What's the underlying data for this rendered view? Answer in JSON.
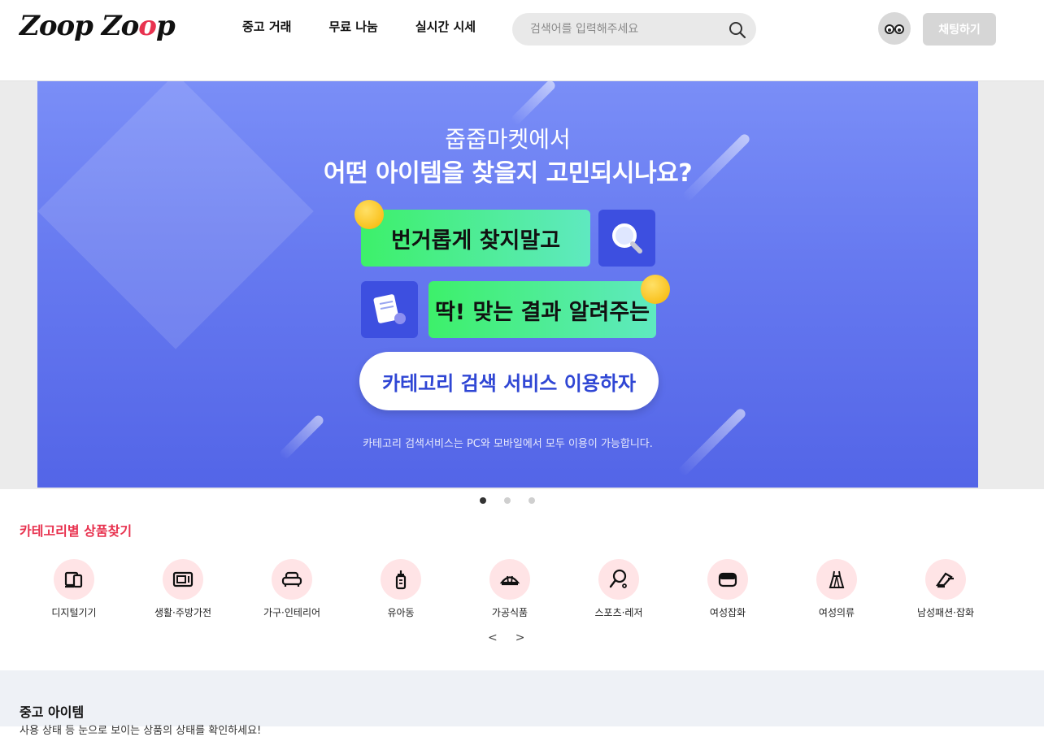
{
  "logo": {
    "text_a": "Zoop Zo",
    "text_b": "o",
    "text_c": "p"
  },
  "nav": [
    {
      "label": "중고 거래"
    },
    {
      "label": "무료 나눔"
    },
    {
      "label": "실시간 시세"
    }
  ],
  "search": {
    "placeholder": "검색어를 입력해주세요",
    "icon": "search-icon"
  },
  "header": {
    "chat_label": "채팅하기",
    "avatar_icon": "avatar-face-icon"
  },
  "banner": {
    "title1": "줍줍마켓에서",
    "title2": "어떤 아이템을 찾을지 고민되시나요?",
    "pill1": "번거롭게 찾지말고",
    "pill2": "딱! 맞는 결과 알려주는",
    "cta": "카테고리 검색 서비스 이용하자",
    "note": "카테고리 검색서비스는 PC와 모바일에서 모두 이용이 가능합니다."
  },
  "carousel": {
    "active_index": 0,
    "count": 3
  },
  "category": {
    "title": "카테고리별 상품찾기",
    "items": [
      {
        "label": "디지털기기",
        "icon": "digital-device-icon"
      },
      {
        "label": "생활·주방가전",
        "icon": "appliance-icon"
      },
      {
        "label": "가구·인테리어",
        "icon": "sofa-icon"
      },
      {
        "label": "유아동",
        "icon": "baby-bottle-icon"
      },
      {
        "label": "가공식품",
        "icon": "food-icon"
      },
      {
        "label": "스포츠·레저",
        "icon": "racket-icon"
      },
      {
        "label": "여성잡화",
        "icon": "bag-icon"
      },
      {
        "label": "여성의류",
        "icon": "dress-icon"
      },
      {
        "label": "남성패션·잡화",
        "icon": "shoe-icon"
      }
    ],
    "prev": "<",
    "next": ">"
  },
  "used": {
    "title": "중고 아이템",
    "subtitle": "사용 상태 등 눈으로 보이는 상품의 상태를 확인하세요!"
  },
  "colors": {
    "accent": "#e8324f",
    "banner_blue": "#5d70ee",
    "pill_green": "#3df06a",
    "category_bg": "#ffe4e6"
  }
}
